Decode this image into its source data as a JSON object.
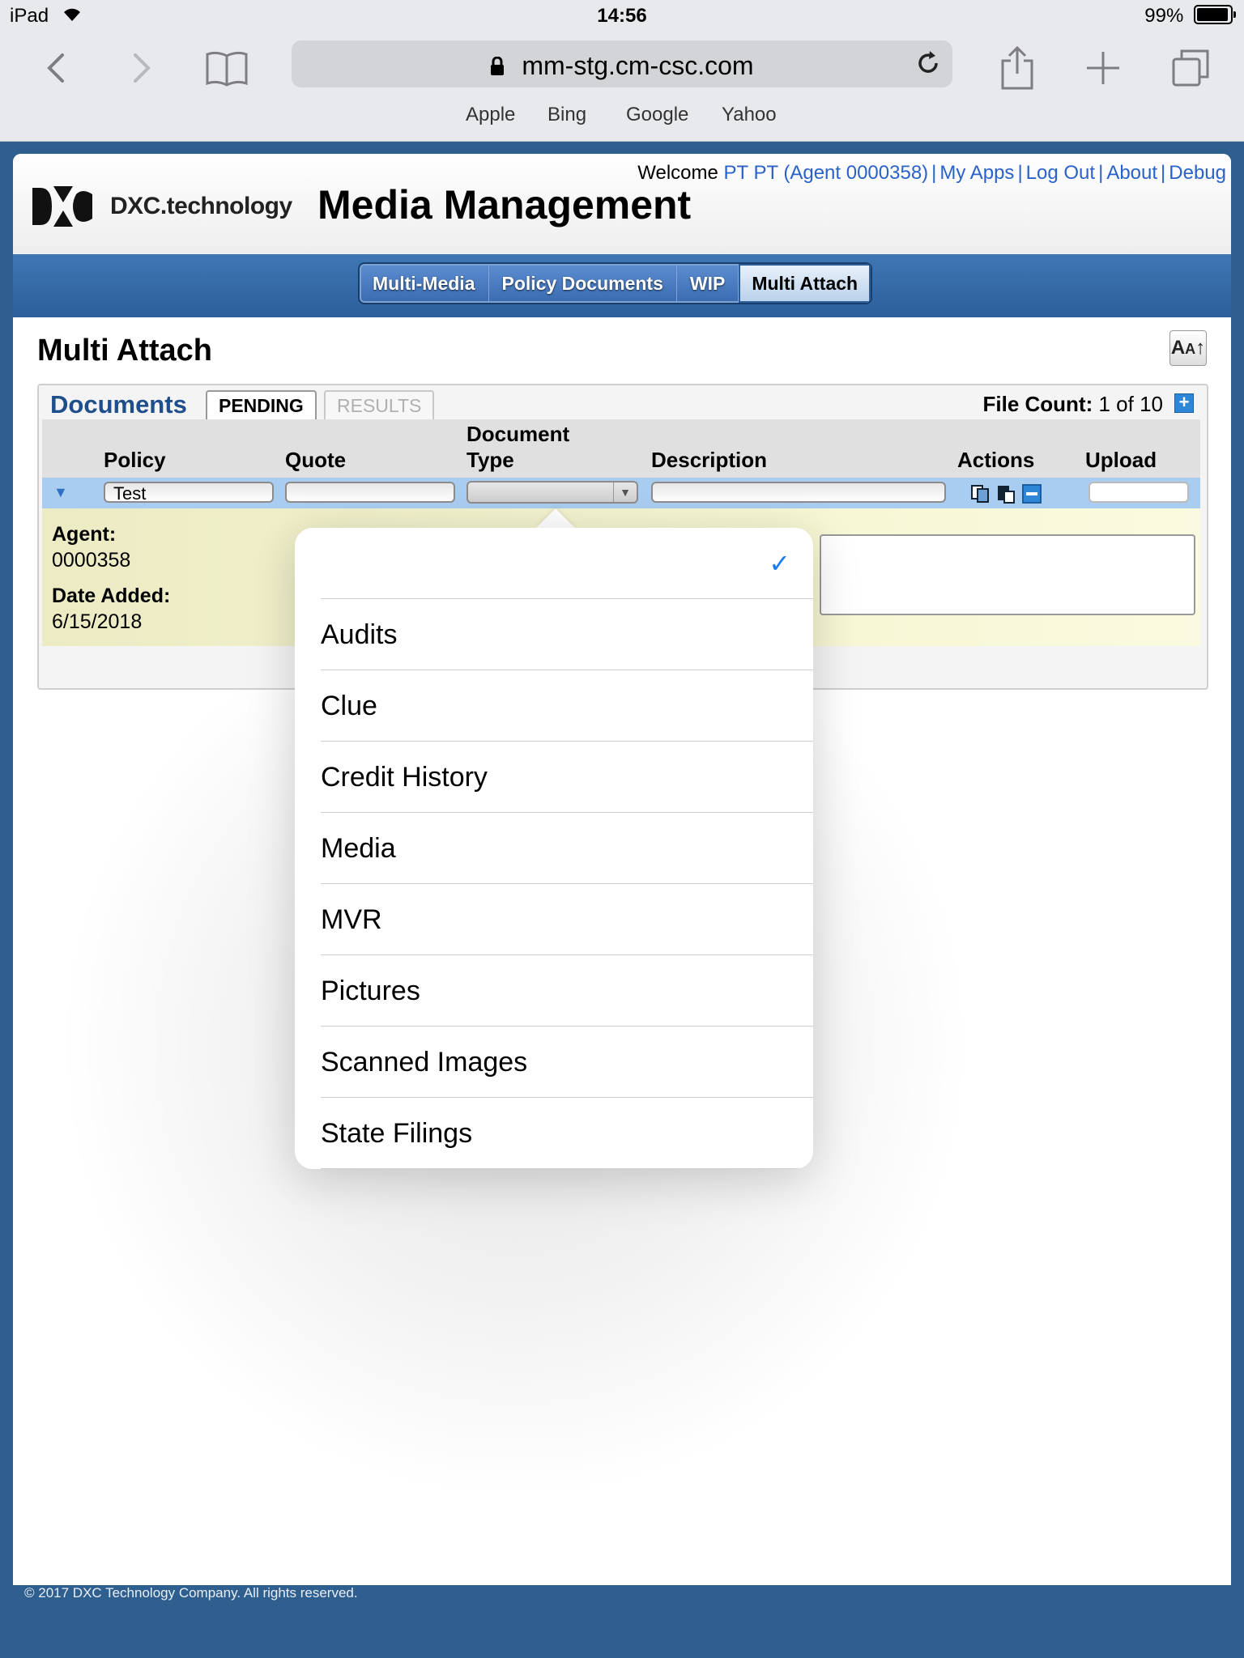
{
  "status": {
    "device": "iPad",
    "time": "14:56",
    "battery": "99%"
  },
  "browser": {
    "url": "mm-stg.cm-csc.com",
    "bookmarks": [
      "Apple",
      "Bing",
      "Google",
      "Yahoo"
    ]
  },
  "header": {
    "logo_text": "DXC.technology",
    "app_title": "Media Management",
    "welcome": "Welcome",
    "user_link": "PT PT (Agent 0000358)",
    "links": [
      "My Apps",
      "Log Out",
      "About",
      "Debug"
    ],
    "separator": "|"
  },
  "nav": {
    "tabs": [
      "Multi-Media",
      "Policy Documents",
      "WIP",
      "Multi Attach"
    ],
    "active": "Multi Attach"
  },
  "main": {
    "title": "Multi Attach",
    "font_button": "AA",
    "documents": {
      "label": "Documents",
      "tab_pending": "PENDING",
      "tab_results": "RESULTS",
      "file_count_label": "File Count:",
      "file_count_value": "1 of 10",
      "add_button": "+",
      "columns": {
        "policy": "Policy",
        "quote": "Quote",
        "doctype_1": "Document",
        "doctype_2": "Type",
        "description": "Description",
        "actions": "Actions",
        "upload": "Upload"
      },
      "row": {
        "policy": "Test",
        "quote": "",
        "document_type": "",
        "description": ""
      },
      "detail": {
        "agent_label": "Agent:",
        "agent_value": "0000358",
        "date_label": "Date Added:",
        "date_value": "6/15/2018"
      }
    }
  },
  "dropdown": {
    "selected": "",
    "options": [
      "",
      "Audits",
      "Clue",
      "Credit History",
      "Media",
      "MVR",
      "Pictures",
      "Scanned Images",
      "State Filings"
    ],
    "check": "✓"
  },
  "footer": "© 2017 DXC Technology Company. All rights reserved."
}
